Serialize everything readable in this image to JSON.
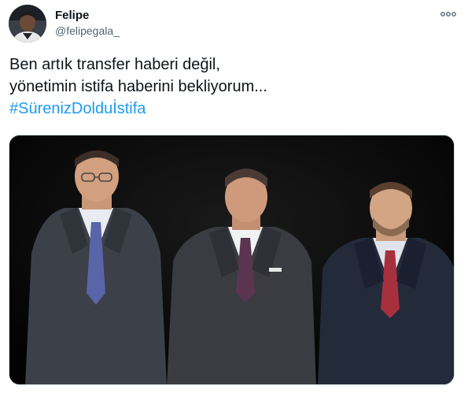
{
  "tweet": {
    "author": {
      "display_name": "Felipe",
      "handle": "@felipegala_",
      "avatar_icon": "profile-photo"
    },
    "more_icon": "more-dots-icon",
    "more_label": "ooo",
    "text_lines": [
      "Ben artık transfer haberi değil,",
      "yönetimin istifa haberini bekliyorum..."
    ],
    "hashtag": "#SürenizDolduİstifa",
    "colors": {
      "text": "#0f1419",
      "secondary": "#536471",
      "link": "#1d9bf0",
      "media_bg": "#050505"
    }
  }
}
